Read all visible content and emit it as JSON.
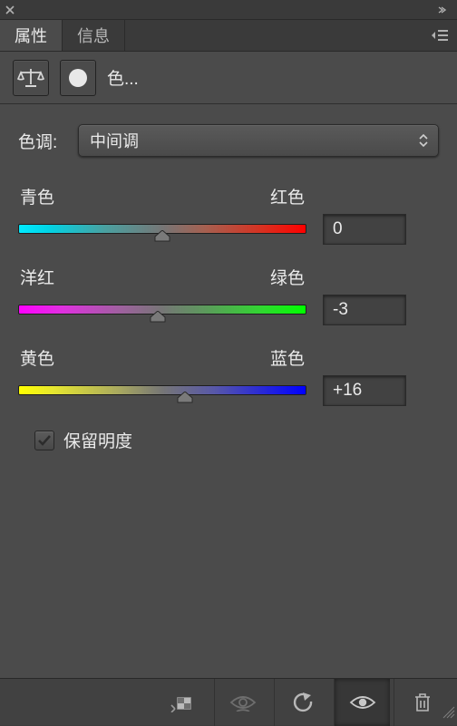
{
  "tabs": {
    "active": "属性",
    "inactive": "信息"
  },
  "adjustment": {
    "title": "色..."
  },
  "tone": {
    "label": "色调:",
    "selected": "中间调"
  },
  "sliders": {
    "cr": {
      "left": "青色",
      "right": "红色",
      "value": "0",
      "pos": 50
    },
    "mg": {
      "left": "洋红",
      "right": "绿色",
      "value": "-3",
      "pos": 48.5
    },
    "yb": {
      "left": "黄色",
      "right": "蓝色",
      "value": "+16",
      "pos": 58
    }
  },
  "preserve": {
    "label": "保留明度",
    "checked": true
  }
}
